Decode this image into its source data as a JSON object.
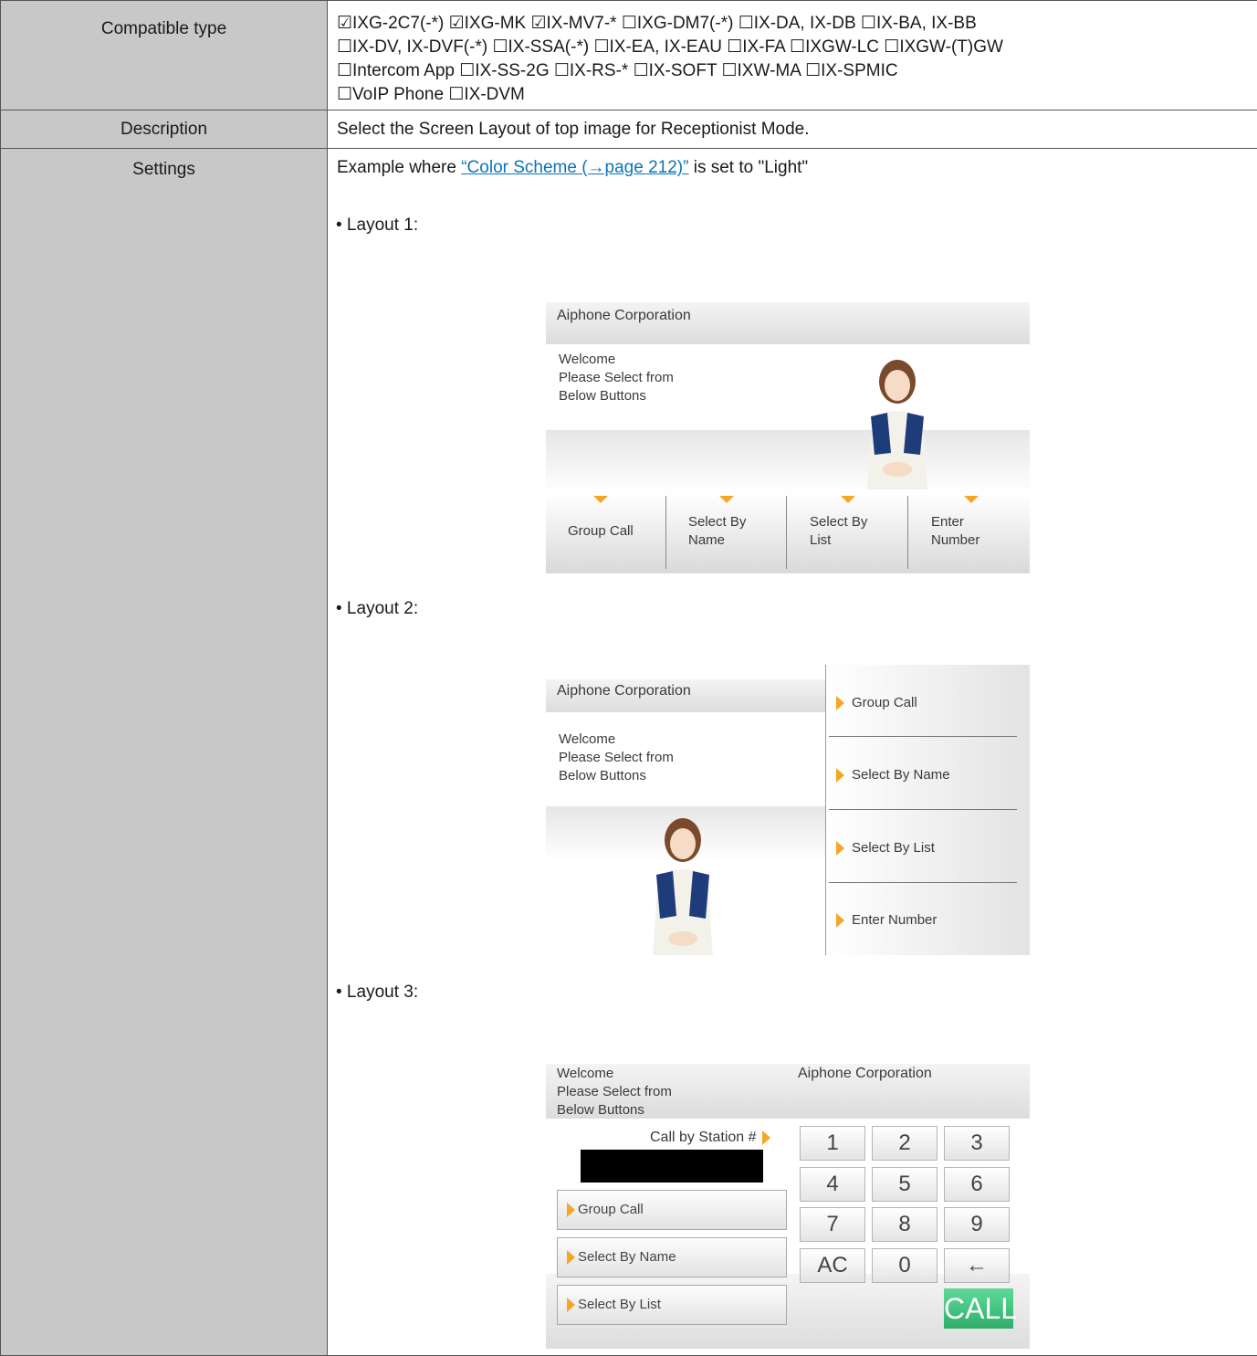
{
  "rows": {
    "compatible": {
      "label": "Compatible type",
      "lines": [
        "☑IXG-2C7(-*) ☑IXG-MK ☑IX-MV7-* ☐IXG-DM7(-*) ☐IX-DA, IX-DB ☐IX-BA, IX-BB",
        "☐IX-DV, IX-DVF(-*) ☐IX-SSA(-*) ☐IX-EA, IX-EAU ☐IX-FA ☐IXGW-LC ☐IXGW-(T)GW",
        "☐Intercom App ☐IX-SS-2G ☐IX-RS-* ☐IX-SOFT ☐IXW-MA ☐IX-SPMIC",
        "☐VoIP Phone ☐IX-DVM"
      ]
    },
    "description": {
      "label": "Description",
      "text": "Select the Screen Layout of top image for Receptionist Mode."
    },
    "settings": {
      "label": "Settings",
      "intro_prefix": "Example where ",
      "intro_link": "“Color Scheme (→page 212)”",
      "intro_suffix": " is set to \"Light\"",
      "layout1_title": "• Layout 1:",
      "layout2_title": "• Layout 2:",
      "layout3_title": "• Layout 3:"
    }
  },
  "screens": {
    "company": "Aiphone Corporation",
    "welcome": [
      "Welcome",
      "Please Select from",
      "Below Buttons"
    ],
    "layout1_buttons": [
      [
        "Group Call"
      ],
      [
        "Select By",
        "Name"
      ],
      [
        "Select By",
        "List"
      ],
      [
        "Enter",
        "Number"
      ]
    ],
    "layout2_buttons": [
      "Group Call",
      "Select By Name",
      "Select By List",
      "Enter Number"
    ],
    "layout3": {
      "call_by_station": "Call by Station #",
      "buttons": [
        "Group Call",
        "Select By Name",
        "Select By List"
      ],
      "keys": [
        "1",
        "2",
        "3",
        "4",
        "5",
        "6",
        "7",
        "8",
        "9",
        "AC",
        "0",
        "←"
      ],
      "call": "CALL"
    }
  },
  "colors": {
    "accent_orange": "#f5a623",
    "link": "#0b74b9",
    "label_bg": "#c8c8c8",
    "call_green": "#3dbf7a"
  }
}
